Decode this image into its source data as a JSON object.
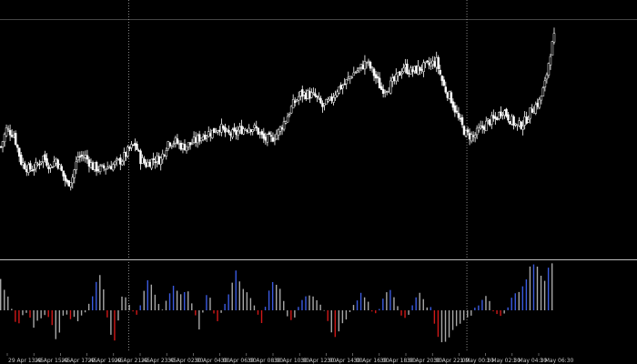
{
  "colors": {
    "background": "#000000",
    "candle_bull_body": "#000000",
    "candle_bull_outline": "#ffffff",
    "candle_bear_body": "#ffffff",
    "wick": "#ffffff",
    "grid_separator": "#bdbdbd",
    "price_line": "#8a8a8a",
    "osc_up": "#3a5ae0",
    "osc_down": "#d01818",
    "osc_neutral": "#a8a8a8"
  },
  "x_labels": [
    "29 Apr 13:45",
    "29 Apr 15:45",
    "29 Apr 17:45",
    "29 Apr 19:45",
    "29 Apr 21:45",
    "29 Apr 23:45",
    "30 Apr 02:00",
    "30 Apr 04:00",
    "30 Apr 06:00",
    "30 Apr 08:00",
    "30 Apr 10:00",
    "30 Apr 12:00",
    "30 Apr 14:00",
    "30 Apr 16:00",
    "30 Apr 18:00",
    "30 Apr 20:00",
    "30 Apr 22:00",
    "1 May 00:30",
    "1 May 02:30",
    "1 May 04:30",
    "1 May 06:30"
  ],
  "chart_data": [
    {
      "type": "candlestick",
      "title": "",
      "xlabel": "",
      "ylabel": "",
      "period_separators": [
        "29 Apr 23:45",
        "1 May 00:30"
      ],
      "close_path": [
        {
          "i": 0,
          "c": 45
        },
        {
          "i": 3,
          "c": 52
        },
        {
          "i": 7,
          "c": 50
        },
        {
          "i": 11,
          "c": 39
        },
        {
          "i": 15,
          "c": 36
        },
        {
          "i": 19,
          "c": 37
        },
        {
          "i": 23,
          "c": 41
        },
        {
          "i": 27,
          "c": 37
        },
        {
          "i": 30,
          "c": 40
        },
        {
          "i": 33,
          "c": 35
        },
        {
          "i": 36,
          "c": 30
        },
        {
          "i": 39,
          "c": 33
        },
        {
          "i": 42,
          "c": 41
        },
        {
          "i": 46,
          "c": 41
        },
        {
          "i": 50,
          "c": 37
        },
        {
          "i": 54,
          "c": 36
        },
        {
          "i": 58,
          "c": 37
        },
        {
          "i": 62,
          "c": 38
        },
        {
          "i": 66,
          "c": 40
        },
        {
          "i": 70,
          "c": 44
        },
        {
          "i": 73,
          "c": 46
        },
        {
          "i": 76,
          "c": 40
        },
        {
          "i": 79,
          "c": 38
        },
        {
          "i": 83,
          "c": 40
        },
        {
          "i": 87,
          "c": 40
        },
        {
          "i": 91,
          "c": 47
        },
        {
          "i": 95,
          "c": 47
        },
        {
          "i": 99,
          "c": 45
        },
        {
          "i": 103,
          "c": 46
        },
        {
          "i": 107,
          "c": 48
        },
        {
          "i": 111,
          "c": 50
        },
        {
          "i": 115,
          "c": 51
        },
        {
          "i": 119,
          "c": 53
        },
        {
          "i": 123,
          "c": 50
        },
        {
          "i": 127,
          "c": 50
        },
        {
          "i": 131,
          "c": 52
        },
        {
          "i": 135,
          "c": 53
        },
        {
          "i": 139,
          "c": 52
        },
        {
          "i": 143,
          "c": 48
        },
        {
          "i": 147,
          "c": 48
        },
        {
          "i": 151,
          "c": 51
        },
        {
          "i": 155,
          "c": 56
        },
        {
          "i": 159,
          "c": 62
        },
        {
          "i": 163,
          "c": 66
        },
        {
          "i": 167,
          "c": 66
        },
        {
          "i": 171,
          "c": 65
        },
        {
          "i": 175,
          "c": 61
        },
        {
          "i": 179,
          "c": 63
        },
        {
          "i": 183,
          "c": 68
        },
        {
          "i": 187,
          "c": 70
        },
        {
          "i": 191,
          "c": 74
        },
        {
          "i": 195,
          "c": 76
        },
        {
          "i": 199,
          "c": 79
        },
        {
          "i": 203,
          "c": 74
        },
        {
          "i": 207,
          "c": 68
        },
        {
          "i": 211,
          "c": 69
        },
        {
          "i": 215,
          "c": 72
        },
        {
          "i": 219,
          "c": 77
        },
        {
          "i": 223,
          "c": 75
        },
        {
          "i": 227,
          "c": 76
        },
        {
          "i": 231,
          "c": 77
        },
        {
          "i": 234,
          "c": 78
        },
        {
          "i": 237,
          "c": 79
        },
        {
          "i": 241,
          "c": 69
        },
        {
          "i": 245,
          "c": 64
        },
        {
          "i": 249,
          "c": 56
        },
        {
          "i": 253,
          "c": 50
        },
        {
          "i": 257,
          "c": 49
        },
        {
          "i": 261,
          "c": 52
        },
        {
          "i": 265,
          "c": 55
        },
        {
          "i": 269,
          "c": 56
        },
        {
          "i": 273,
          "c": 60
        },
        {
          "i": 277,
          "c": 56
        },
        {
          "i": 281,
          "c": 53
        },
        {
          "i": 285,
          "c": 55
        },
        {
          "i": 289,
          "c": 60
        },
        {
          "i": 293,
          "c": 63
        },
        {
          "i": 296,
          "c": 70
        },
        {
          "i": 299,
          "c": 83
        },
        {
          "i": 302,
          "c": 91
        }
      ],
      "candle_count": 302,
      "ylim": [
        0,
        100
      ],
      "current_price": 96
    },
    {
      "type": "histogram",
      "title": "",
      "levels": [
        {
          "i": 0,
          "v": 30
        },
        {
          "i": 2,
          "v": 22
        },
        {
          "i": 5,
          "v": 10
        },
        {
          "i": 7,
          "v": -6
        },
        {
          "i": 9,
          "v": -18
        },
        {
          "i": 11,
          "v": -8
        },
        {
          "i": 14,
          "v": -2
        },
        {
          "i": 16,
          "v": -6
        },
        {
          "i": 18,
          "v": -16
        },
        {
          "i": 20,
          "v": -10
        },
        {
          "i": 22,
          "v": -8
        },
        {
          "i": 24,
          "v": -4
        },
        {
          "i": 26,
          "v": -6
        },
        {
          "i": 28,
          "v": -14
        },
        {
          "i": 30,
          "v": -30
        },
        {
          "i": 32,
          "v": -22
        },
        {
          "i": 34,
          "v": -6
        },
        {
          "i": 36,
          "v": -4
        },
        {
          "i": 38,
          "v": -8
        },
        {
          "i": 40,
          "v": -6
        },
        {
          "i": 42,
          "v": -10
        },
        {
          "i": 44,
          "v": -4
        },
        {
          "i": 46,
          "v": -2
        },
        {
          "i": 48,
          "v": 6
        },
        {
          "i": 50,
          "v": 14
        },
        {
          "i": 52,
          "v": 28
        },
        {
          "i": 54,
          "v": 36
        },
        {
          "i": 56,
          "v": 20
        },
        {
          "i": 58,
          "v": -6
        },
        {
          "i": 60,
          "v": -24
        },
        {
          "i": 62,
          "v": -30
        },
        {
          "i": 64,
          "v": -10
        },
        {
          "i": 66,
          "v": 14
        },
        {
          "i": 68,
          "v": 12
        },
        {
          "i": 70,
          "v": 4
        },
        {
          "i": 72,
          "v": -2
        },
        {
          "i": 74,
          "v": -4
        },
        {
          "i": 76,
          "v": 6
        },
        {
          "i": 78,
          "v": 18
        },
        {
          "i": 80,
          "v": 30
        },
        {
          "i": 82,
          "v": 26
        },
        {
          "i": 84,
          "v": 16
        },
        {
          "i": 86,
          "v": 6
        },
        {
          "i": 88,
          "v": 2
        },
        {
          "i": 90,
          "v": 10
        },
        {
          "i": 92,
          "v": 18
        },
        {
          "i": 94,
          "v": 24
        },
        {
          "i": 96,
          "v": 20
        },
        {
          "i": 98,
          "v": 16
        },
        {
          "i": 100,
          "v": 18
        },
        {
          "i": 102,
          "v": 18
        },
        {
          "i": 104,
          "v": 8
        },
        {
          "i": 106,
          "v": -4
        },
        {
          "i": 108,
          "v": -18
        },
        {
          "i": 110,
          "v": -2
        },
        {
          "i": 112,
          "v": 14
        },
        {
          "i": 114,
          "v": 12
        },
        {
          "i": 116,
          "v": -4
        },
        {
          "i": 118,
          "v": -10
        },
        {
          "i": 120,
          "v": -4
        },
        {
          "i": 122,
          "v": 6
        },
        {
          "i": 124,
          "v": 16
        },
        {
          "i": 126,
          "v": 28
        },
        {
          "i": 128,
          "v": 40
        },
        {
          "i": 130,
          "v": 30
        },
        {
          "i": 132,
          "v": 22
        },
        {
          "i": 134,
          "v": 18
        },
        {
          "i": 136,
          "v": 12
        },
        {
          "i": 138,
          "v": 6
        },
        {
          "i": 140,
          "v": -4
        },
        {
          "i": 142,
          "v": -12
        },
        {
          "i": 144,
          "v": 4
        },
        {
          "i": 146,
          "v": 20
        },
        {
          "i": 148,
          "v": 28
        },
        {
          "i": 150,
          "v": 26
        },
        {
          "i": 152,
          "v": 20
        },
        {
          "i": 154,
          "v": 8
        },
        {
          "i": 156,
          "v": -6
        },
        {
          "i": 158,
          "v": -10
        },
        {
          "i": 160,
          "v": -8
        },
        {
          "i": 162,
          "v": 4
        },
        {
          "i": 164,
          "v": 10
        },
        {
          "i": 166,
          "v": 14
        },
        {
          "i": 168,
          "v": 16
        },
        {
          "i": 170,
          "v": 14
        },
        {
          "i": 172,
          "v": 10
        },
        {
          "i": 174,
          "v": 6
        },
        {
          "i": 176,
          "v": 0
        },
        {
          "i": 178,
          "v": -10
        },
        {
          "i": 180,
          "v": -22
        },
        {
          "i": 182,
          "v": -26
        },
        {
          "i": 184,
          "v": -20
        },
        {
          "i": 186,
          "v": -14
        },
        {
          "i": 188,
          "v": -8
        },
        {
          "i": 190,
          "v": -2
        },
        {
          "i": 192,
          "v": 4
        },
        {
          "i": 194,
          "v": 10
        },
        {
          "i": 196,
          "v": 16
        },
        {
          "i": 198,
          "v": 14
        },
        {
          "i": 200,
          "v": 8
        },
        {
          "i": 202,
          "v": -2
        },
        {
          "i": 204,
          "v": -4
        },
        {
          "i": 206,
          "v": 2
        },
        {
          "i": 208,
          "v": 12
        },
        {
          "i": 210,
          "v": 18
        },
        {
          "i": 212,
          "v": 20
        },
        {
          "i": 214,
          "v": 14
        },
        {
          "i": 216,
          "v": 4
        },
        {
          "i": 218,
          "v": -4
        },
        {
          "i": 220,
          "v": -8
        },
        {
          "i": 222,
          "v": -4
        },
        {
          "i": 224,
          "v": 6
        },
        {
          "i": 226,
          "v": 14
        },
        {
          "i": 228,
          "v": 18
        },
        {
          "i": 230,
          "v": 12
        },
        {
          "i": 232,
          "v": 4
        },
        {
          "i": 234,
          "v": 2
        },
        {
          "i": 236,
          "v": -14
        },
        {
          "i": 238,
          "v": -28
        },
        {
          "i": 240,
          "v": -32
        },
        {
          "i": 242,
          "v": -30
        },
        {
          "i": 244,
          "v": -26
        },
        {
          "i": 246,
          "v": -20
        },
        {
          "i": 248,
          "v": -16
        },
        {
          "i": 250,
          "v": -12
        },
        {
          "i": 252,
          "v": -10
        },
        {
          "i": 254,
          "v": -8
        },
        {
          "i": 256,
          "v": -4
        },
        {
          "i": 258,
          "v": 2
        },
        {
          "i": 260,
          "v": 6
        },
        {
          "i": 262,
          "v": 10
        },
        {
          "i": 264,
          "v": 14
        },
        {
          "i": 266,
          "v": 8
        },
        {
          "i": 268,
          "v": 0
        },
        {
          "i": 270,
          "v": -4
        },
        {
          "i": 272,
          "v": -6
        },
        {
          "i": 274,
          "v": -2
        },
        {
          "i": 276,
          "v": 4
        },
        {
          "i": 278,
          "v": 12
        },
        {
          "i": 280,
          "v": 16
        },
        {
          "i": 282,
          "v": 18
        },
        {
          "i": 284,
          "v": 24
        },
        {
          "i": 286,
          "v": 30
        },
        {
          "i": 288,
          "v": 44
        },
        {
          "i": 290,
          "v": 46
        },
        {
          "i": 292,
          "v": 44
        },
        {
          "i": 294,
          "v": 36
        },
        {
          "i": 296,
          "v": 28
        },
        {
          "i": 298,
          "v": 44
        },
        {
          "i": 300,
          "v": 46
        },
        {
          "i": 302,
          "v": 44
        }
      ],
      "ylim": [
        -50,
        50
      ]
    }
  ]
}
